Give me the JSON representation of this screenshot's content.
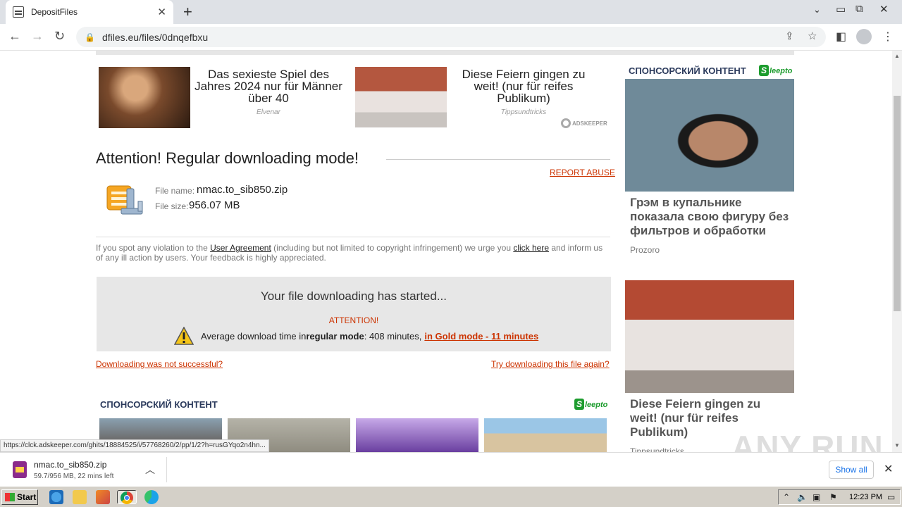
{
  "browser": {
    "tab_title": "DepositFiles",
    "tab_close": "✕",
    "new_tab": "+",
    "url": "dfiles.eu/files/0dnqefbxu"
  },
  "ads_top": [
    {
      "headline": "Das sexieste Spiel des Jahres 2024 nur für Männer über 40",
      "source": "Elvenar"
    },
    {
      "headline": "Diese Feiern gingen zu weit! (nur für reifes Publikum)",
      "source": "Tippsundtricks"
    }
  ],
  "adkeeper_label": "ADSKEEPER",
  "download": {
    "title": "Attention! Regular downloading mode!",
    "report_abuse": "REPORT ABUSE",
    "file_name_label": "File name:",
    "file_name": "nmac.to_sib850.zip",
    "file_size_label": "File size:",
    "file_size": "956.07 MB",
    "notice_before": "If you spot any violation to the ",
    "notice_link1": "User Agreement",
    "notice_mid": " (including but not limited to copyright infringement) we urge you ",
    "notice_link2": "click here",
    "notice_after": " and inform us of any ill action by users. Your feedback is highly appreciated.",
    "started": "Your file downloading has started...",
    "attention": "ATTENTION!",
    "avg_before": "Average download time in ",
    "avg_mode": "regular mode",
    "avg_after": ": 408 minutes,",
    "gold_link": "in Gold mode - 11 minutes",
    "fail_link": "Downloading was not successful?",
    "retry_link": "Try downloading this file again?"
  },
  "sponsored_label": "СПОНСОРСКИЙ КОНТЕНТ",
  "sleepto_label": "leepto",
  "sleepto_s": "S",
  "side_ads": [
    {
      "headline": "Грэм в купальнике показала свою фигуру без фильтров и обработки",
      "source": "Prozoro"
    },
    {
      "headline": "Diese Feiern gingen zu weit! (nur für reifes Publikum)",
      "source": "Tippsundtricks"
    }
  ],
  "status_url": "https://clck.adskeeper.com/ghits/18884525/i/57768260/2/pp/1/2?h=rusGYqo2n4hn...",
  "watermark": "ANY RUN",
  "download_bar": {
    "file": "nmac.to_sib850.zip",
    "progress": "59.7/956 MB, 22 mins left",
    "show_all": "Show all"
  },
  "taskbar": {
    "start": "Start",
    "clock": "12:23 PM"
  }
}
